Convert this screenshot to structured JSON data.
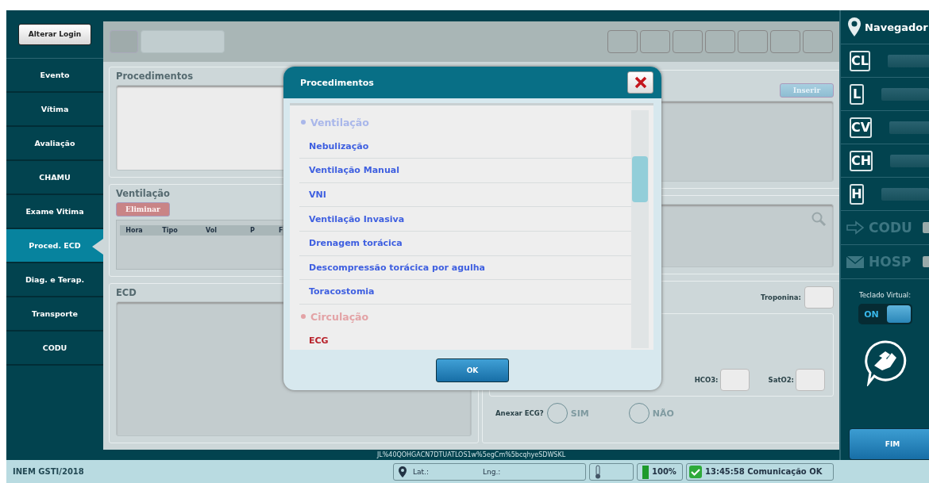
{
  "sidebar": {
    "login_button": "Alterar Login",
    "items": [
      {
        "label": "Evento",
        "selected": false
      },
      {
        "label": "Vítima",
        "selected": false
      },
      {
        "label": "Avaliação",
        "selected": false
      },
      {
        "label": "CHAMU",
        "selected": false
      },
      {
        "label": "Exame Vitima",
        "selected": false
      },
      {
        "label": "Proced.  ECD",
        "selected": true
      },
      {
        "label": "Diag. e Terap.",
        "selected": false
      },
      {
        "label": "Transporte",
        "selected": false
      },
      {
        "label": "CODU",
        "selected": false
      }
    ]
  },
  "content": {
    "procedures": {
      "title": "Procedimentos"
    },
    "ventilation": {
      "title": "Ventilação",
      "delete_button": {
        "label": "Eliminar",
        "disabled": true
      },
      "columns": [
        "Hora",
        "Tipo",
        "Vol",
        "P",
        "F"
      ]
    },
    "ecd": {
      "title": "ECD"
    },
    "insert_button": {
      "label": "Inserir",
      "disabled": true
    },
    "troponin_label": "Troponina:",
    "hco3_label": "HCO3:",
    "sato2_label": "SatO2:",
    "attach_ecg": {
      "label": "Anexar ECG?",
      "options": [
        {
          "label": "SIM",
          "selected": false
        },
        {
          "label": "NÃO",
          "selected": false
        }
      ]
    },
    "session_code": "JL%40QOHGACN7DTUATLOS1w%5egCm%5bcqhyeSDWSKL"
  },
  "dialog": {
    "title": "Procedimentos",
    "entries": [
      {
        "kind": "group",
        "label": "Ventilação",
        "color": "#a9b7ea"
      },
      {
        "kind": "item",
        "label": "Nebulização",
        "color": "#3e5fe0"
      },
      {
        "kind": "item",
        "label": "Ventilação Manual",
        "color": "#3e5fe0"
      },
      {
        "kind": "item",
        "label": "VNI",
        "color": "#3e5fe0"
      },
      {
        "kind": "item",
        "label": "Ventilação Invasiva",
        "color": "#3e5fe0"
      },
      {
        "kind": "item",
        "label": "Drenagem torácica",
        "color": "#3e5fe0"
      },
      {
        "kind": "item",
        "label": "Descompressão torácica por agulha",
        "color": "#3e5fe0"
      },
      {
        "kind": "item",
        "label": "Toracostomia",
        "color": "#3e5fe0"
      },
      {
        "kind": "group",
        "label": "Circulação",
        "color": "#e3a3a6"
      },
      {
        "kind": "item",
        "label": "ECG",
        "color": "#b8222b"
      }
    ],
    "ok_button": "OK"
  },
  "navigator": {
    "title": "Navegador",
    "channels": [
      {
        "code": "CL"
      },
      {
        "code": "L"
      },
      {
        "code": "CV"
      },
      {
        "code": "CH"
      },
      {
        "code": "H"
      }
    ],
    "links": [
      {
        "kind": "arrow",
        "label": "CODU",
        "disabled": true
      },
      {
        "kind": "mail",
        "label": "HOSP",
        "disabled": true
      }
    ],
    "keyboard": {
      "label": "Teclado Virtual:",
      "state_label": "ON",
      "on": true
    },
    "finish_button": "FIM"
  },
  "status_bar": {
    "organization": "INEM GSTI/2018",
    "lat_label": "Lat.:",
    "lng_label": "Lng.:",
    "battery": "100%",
    "connection": "13:45:58 Comunicação OK"
  }
}
